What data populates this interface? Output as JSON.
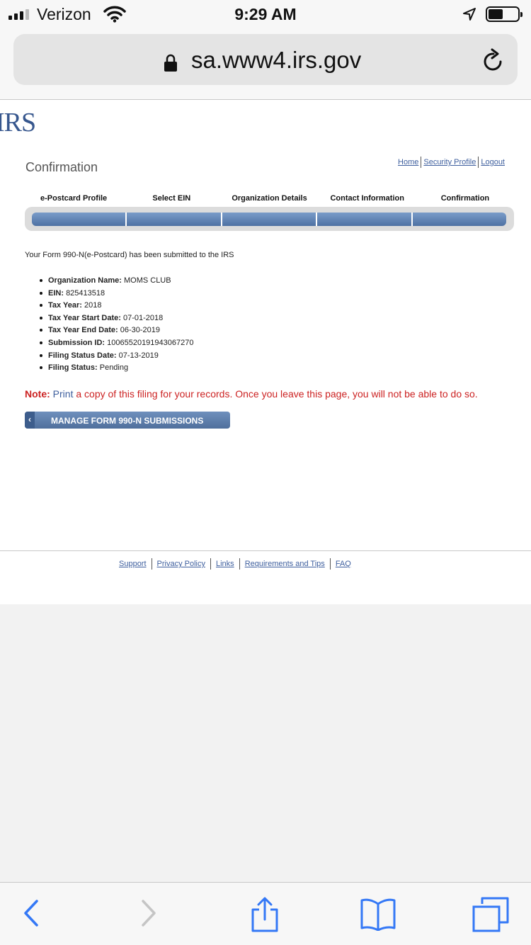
{
  "status": {
    "carrier": "Verizon",
    "time": "9:29 AM"
  },
  "browser": {
    "url": "sa.www4.irs.gov"
  },
  "header": {
    "logo": "IRS",
    "title": "Confirmation",
    "links": {
      "home": "Home",
      "security_profile": "Security Profile",
      "logout": "Logout"
    }
  },
  "steps": [
    "e-Postcard Profile",
    "Select EIN",
    "Organization Details",
    "Contact Information",
    "Confirmation"
  ],
  "message": "Your Form 990-N(e-Postcard) has been submitted to the IRS",
  "details": [
    {
      "label": "Organization Name:",
      "value": "MOMS CLUB"
    },
    {
      "label": "EIN:",
      "value": "825413518"
    },
    {
      "label": "Tax Year:",
      "value": "2018"
    },
    {
      "label": "Tax Year Start Date:",
      "value": "07-01-2018"
    },
    {
      "label": "Tax Year End Date:",
      "value": "06-30-2019"
    },
    {
      "label": "Submission ID:",
      "value": "10065520191943067270"
    },
    {
      "label": "Filing Status Date:",
      "value": "07-13-2019"
    },
    {
      "label": "Filing Status:",
      "value": "Pending"
    }
  ],
  "note": {
    "label": "Note:",
    "link": "Print",
    "text": "a copy of this filing for your records. Once you leave this page, you will not be able to do so."
  },
  "manage_button": {
    "chevron": "‹",
    "label": "MANAGE FORM 990-N SUBMISSIONS"
  },
  "footer": {
    "support": "Support",
    "privacy": "Privacy Policy",
    "links": "Links",
    "requirements": "Requirements and Tips",
    "faq": "FAQ"
  },
  "icons": {
    "back": "back-icon",
    "forward": "forward-icon",
    "share": "share-icon",
    "bookmarks": "bookmarks-icon",
    "tabs": "tabs-icon",
    "accent": "#3478f6"
  }
}
